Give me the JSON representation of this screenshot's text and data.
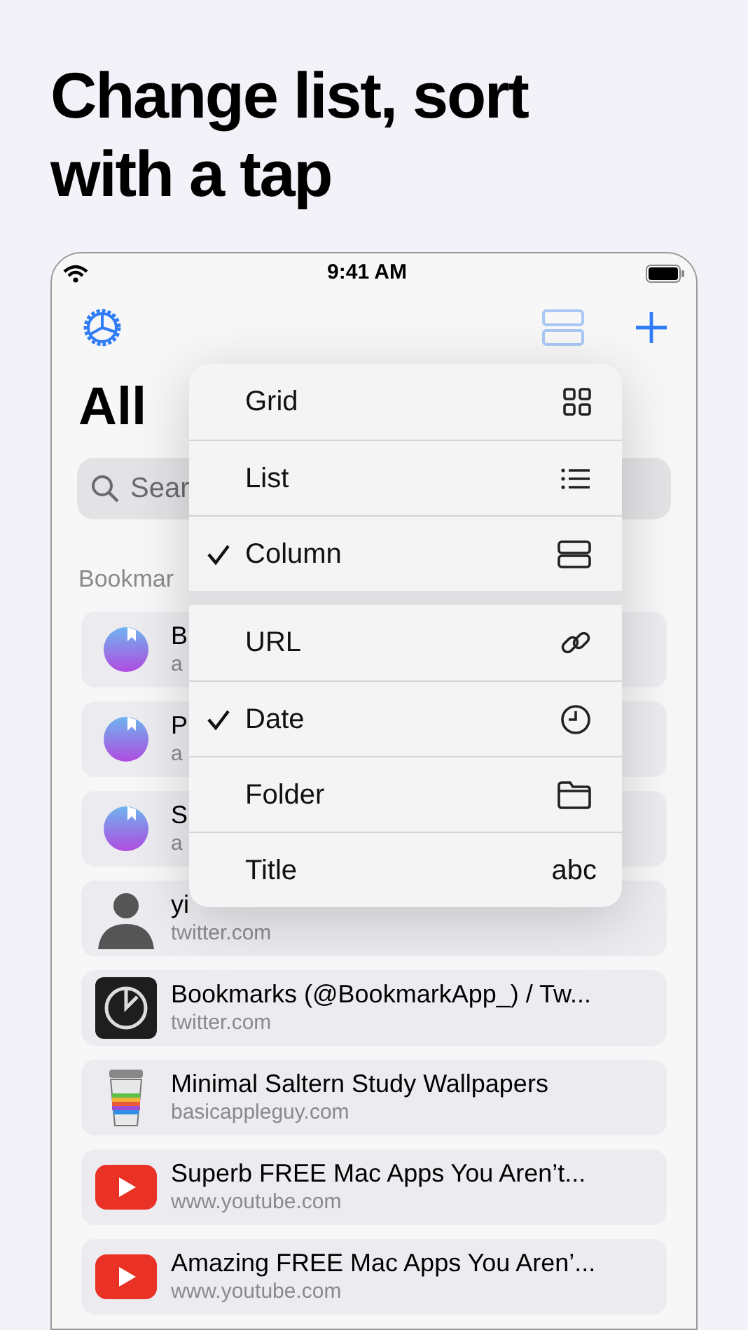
{
  "headline": "Change list, sort with a tap",
  "status_bar": {
    "time": "9:41 AM"
  },
  "title": "All",
  "search": {
    "placeholder": "Sear"
  },
  "section": "Bookmar",
  "bookmarks": [
    {
      "kind": "app",
      "title": "B",
      "url": "a"
    },
    {
      "kind": "app",
      "title": "P",
      "url": "a"
    },
    {
      "kind": "app",
      "title": "S",
      "url": "a"
    },
    {
      "kind": "person",
      "title": "yi",
      "url": "twitter.com"
    },
    {
      "kind": "logo",
      "title": "Bookmarks (@BookmarkApp_) / Tw...",
      "url": "twitter.com"
    },
    {
      "kind": "cup",
      "title": "Minimal Saltern Study Wallpapers",
      "url": "basicappleguy.com"
    },
    {
      "kind": "video",
      "title": "Superb FREE Mac Apps You Aren’t...",
      "url": "www.youtube.com"
    },
    {
      "kind": "video",
      "title": "Amazing FREE Mac Apps You Aren’...",
      "url": "www.youtube.com"
    }
  ],
  "menu": {
    "groups": [
      [
        {
          "label": "Grid",
          "kind": "grid",
          "selected": false
        },
        {
          "label": "List",
          "kind": "list",
          "selected": false
        },
        {
          "label": "Column",
          "kind": "column",
          "selected": true
        }
      ],
      [
        {
          "label": "URL",
          "kind": "link",
          "selected": false
        },
        {
          "label": "Date",
          "kind": "clock",
          "selected": true
        },
        {
          "label": "Folder",
          "kind": "folder",
          "selected": false
        },
        {
          "label": "Title",
          "kind": "text",
          "trailing_text": "abc",
          "selected": false
        }
      ]
    ]
  }
}
